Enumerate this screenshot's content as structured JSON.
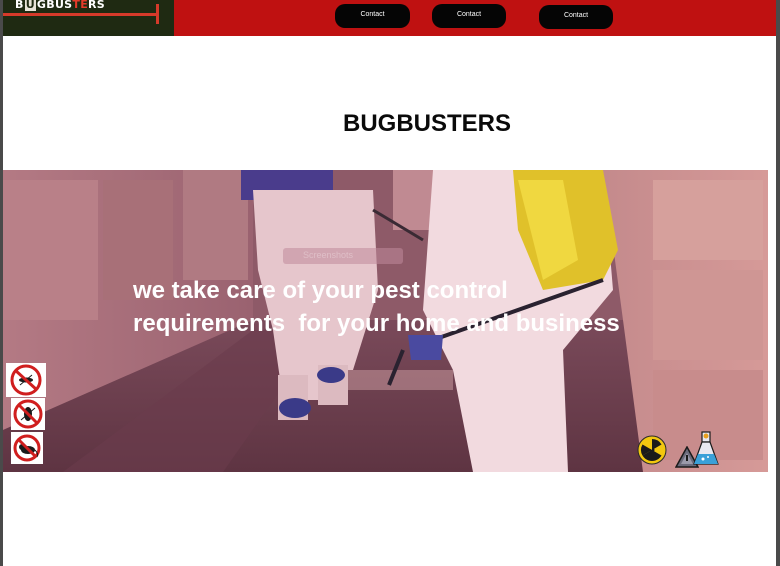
{
  "logo": {
    "text_part1": "B",
    "text_box": "U",
    "text_part2": "G",
    "text_part3": "BUS",
    "text_part4": "TE",
    "text_part5": "RS"
  },
  "nav": {
    "items": [
      {
        "label": "Contact"
      },
      {
        "label": "Contact"
      },
      {
        "label": "Contact"
      }
    ]
  },
  "page_title": "BUGBUSTERS",
  "hero": {
    "headline": "we take care of your pest control\nrequirements  for your home and business",
    "watermark": "Screenshots"
  },
  "icons": {
    "pest_signs": [
      "no-mosquito-icon",
      "no-cockroach-icon",
      "no-rat-icon"
    ],
    "hazard": [
      "radiation-icon",
      "warning-triangle-icon",
      "chemical-flask-icon"
    ]
  },
  "colors": {
    "topbar": "#bf1111",
    "logo_bg": "#1f2a12",
    "nav_button": "#050505",
    "hero_tint": "#8e5a68",
    "radiation_yellow": "#f2c70f",
    "flask_blue": "#3aa0d8"
  }
}
